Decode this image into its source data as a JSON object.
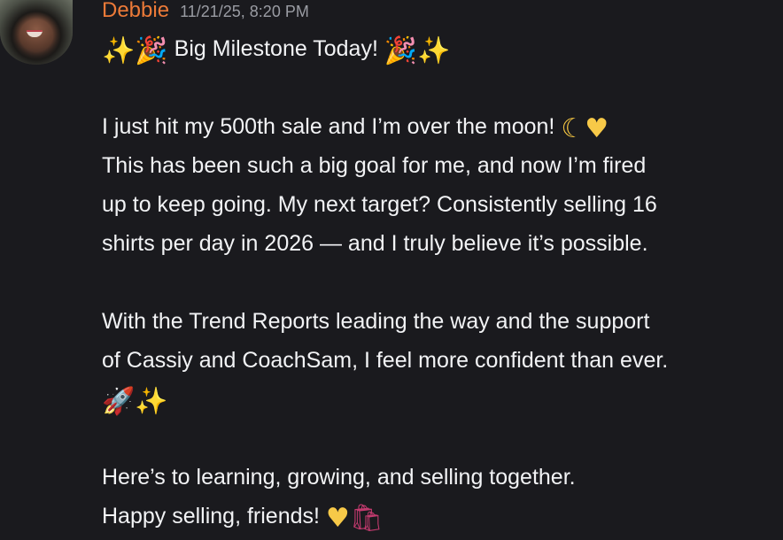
{
  "message": {
    "author": "Debbie",
    "timestamp": "11/21/25, 8:20 PM",
    "lines": {
      "title": "Big Milestone Today!",
      "p1_l1": "I just hit my 500th sale and I’m over the moon!",
      "p1_l2": "This has been such a big goal for me, and now I’m fired",
      "p1_l3": "up to keep going. My next target? Consistently selling 16",
      "p1_l4": "shirts per day in 2026 — and I truly believe it’s possible.",
      "p2_l1": "With the Trend Reports leading the way and the support",
      "p2_l2": "of Cassiy and CoachSam, I feel more confident than ever.",
      "p3_l1": "Here’s to learning, growing, and selling together.",
      "p3_l2": "Happy selling, friends!"
    }
  },
  "emojis": {
    "sparkles": "✨",
    "party": "🎉",
    "moon": "☾",
    "heart": "♥",
    "rocket": "🚀",
    "bags": "🛍"
  }
}
